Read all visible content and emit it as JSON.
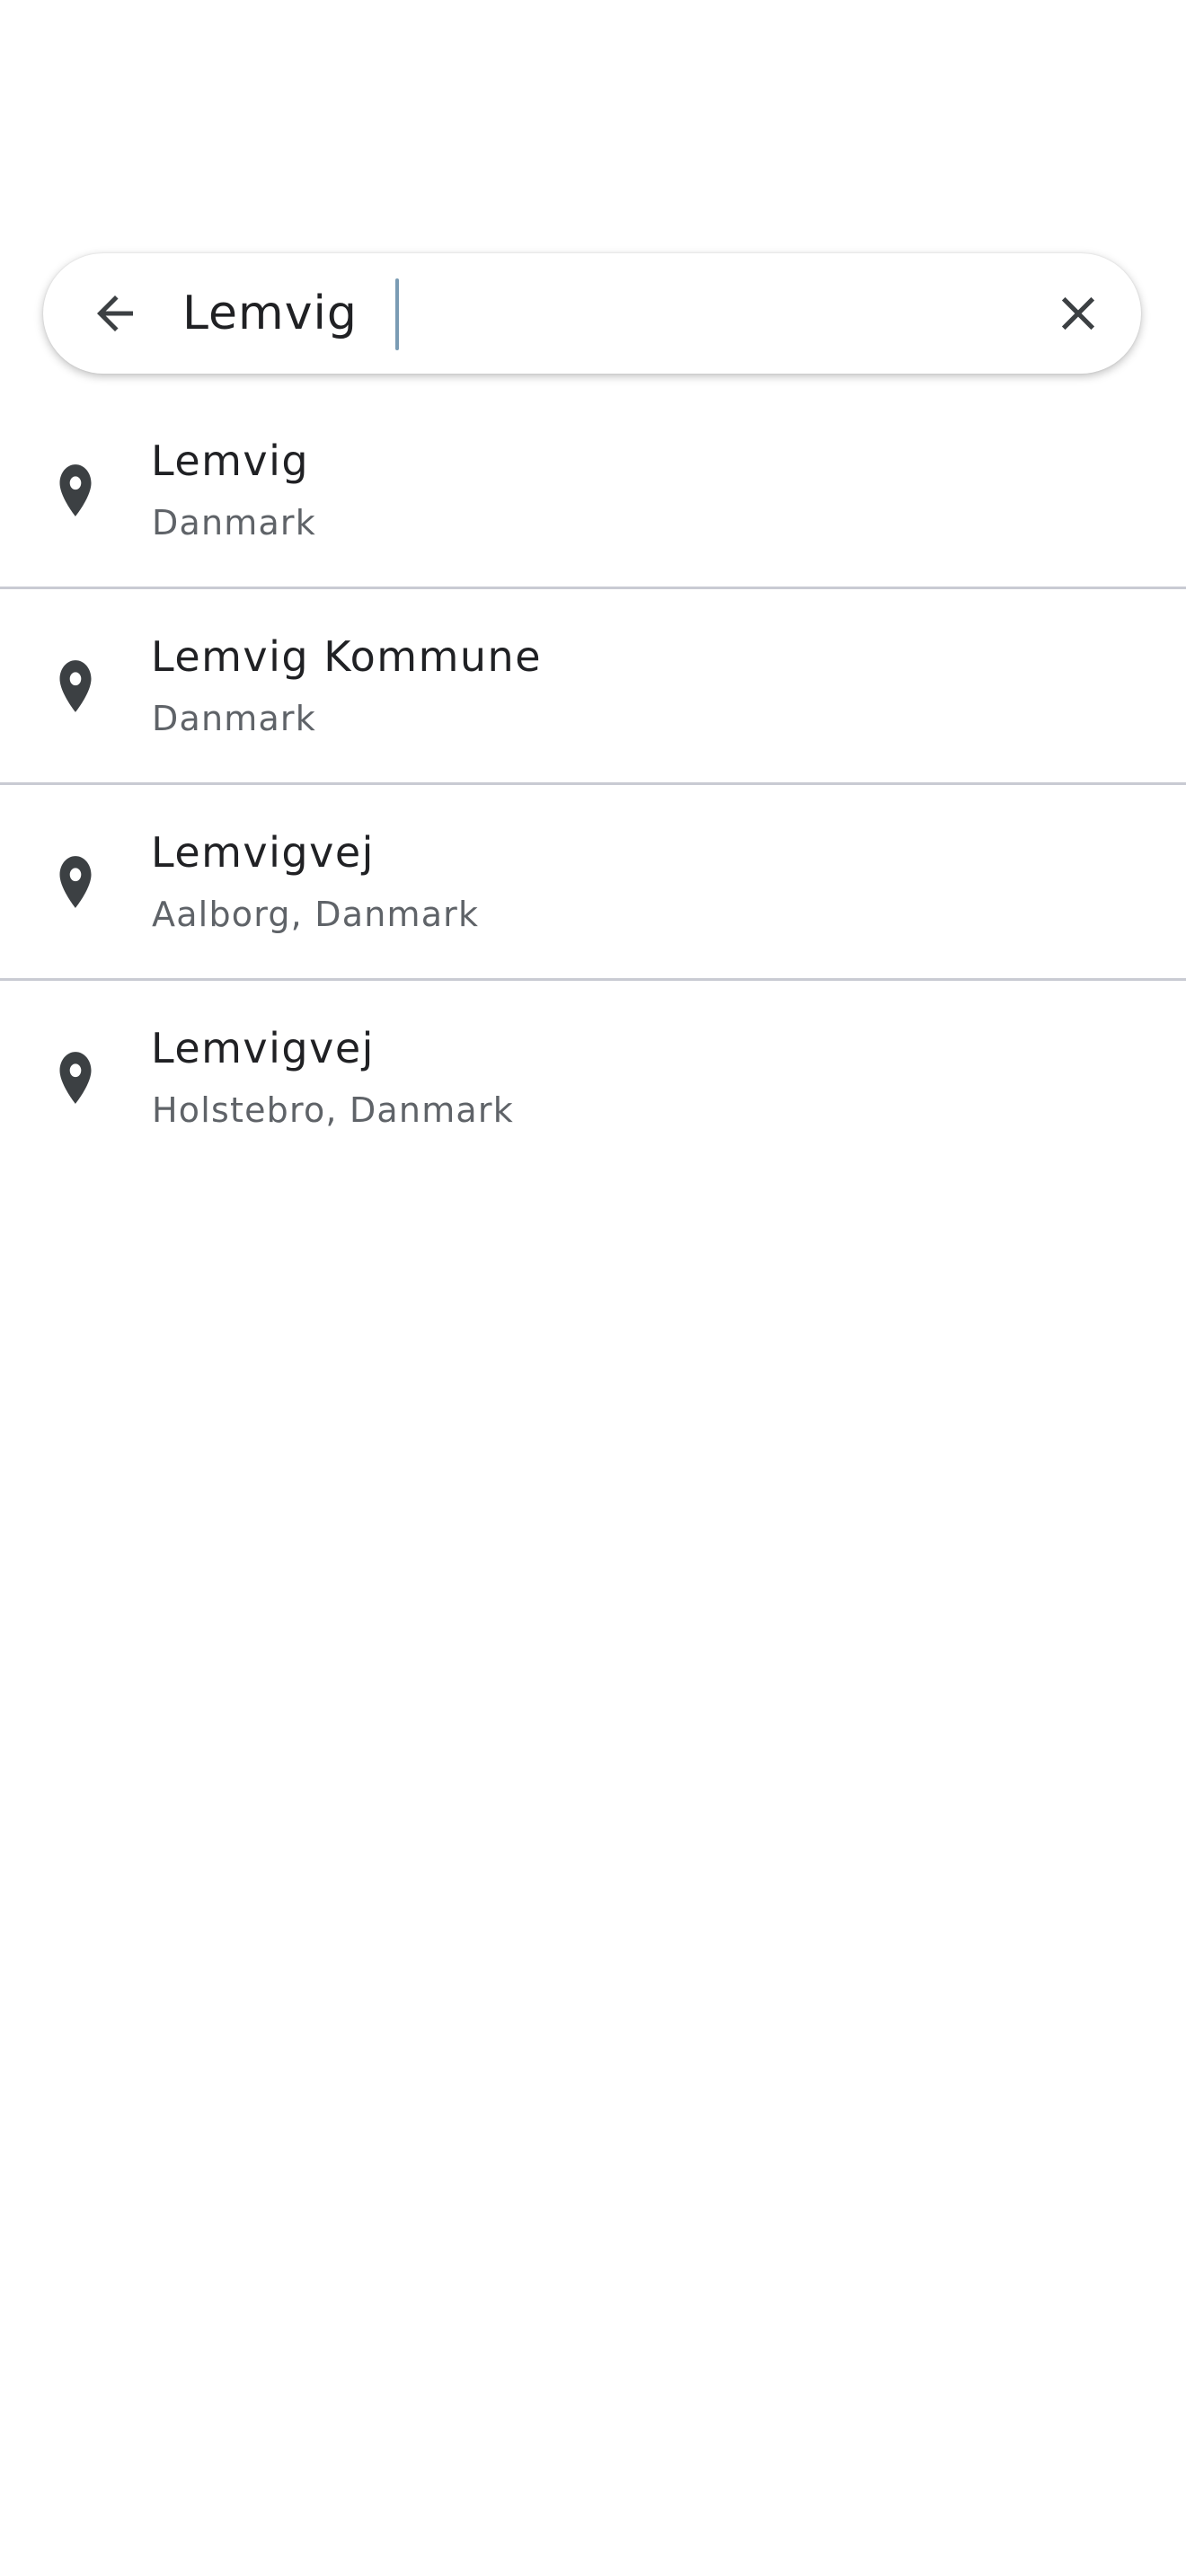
{
  "search": {
    "query": "Lemvig",
    "back_icon": "arrow-back-icon",
    "clear_icon": "close-icon"
  },
  "results": [
    {
      "title": "Lemvig",
      "subtitle": "Danmark",
      "icon": "location-pin-icon"
    },
    {
      "title": "Lemvig Kommune",
      "subtitle": "Danmark",
      "icon": "location-pin-icon"
    },
    {
      "title": "Lemvigvej",
      "subtitle": "Aalborg, Danmark",
      "icon": "location-pin-icon"
    },
    {
      "title": "Lemvigvej",
      "subtitle": "Holstebro, Danmark",
      "icon": "location-pin-icon"
    }
  ],
  "colors": {
    "icon": "#3c4043",
    "caret": "#7a9cb4",
    "divider": "#c9cbd3",
    "subtitle": "#5f6368"
  }
}
